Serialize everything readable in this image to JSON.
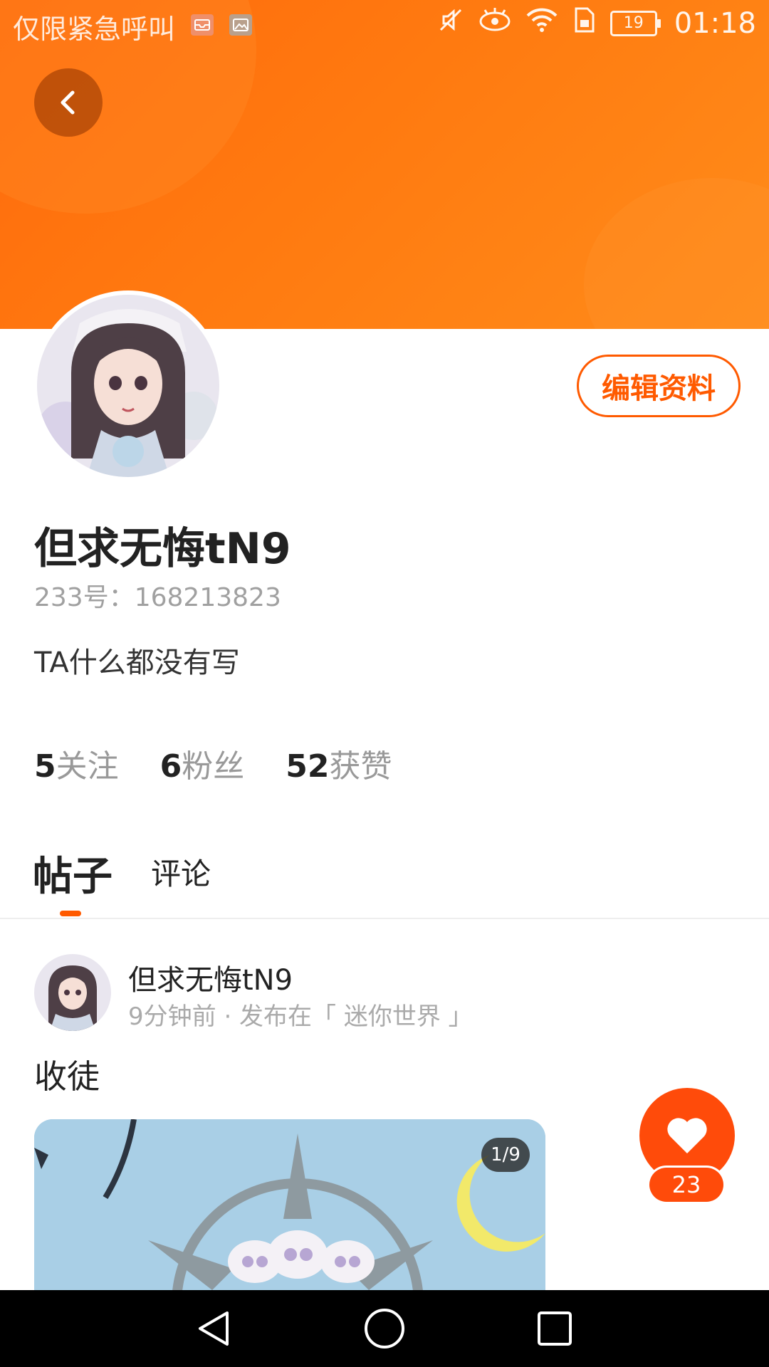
{
  "status_bar": {
    "carrier_text": "仅限紧急呼叫",
    "battery": "19",
    "time": "01:18",
    "icons": [
      "notification-mail-icon",
      "notification-image-icon",
      "mute-icon",
      "eye-comfort-icon",
      "wifi-icon",
      "sim-icon",
      "battery-icon"
    ]
  },
  "header": {
    "back_icon": "chevron-left-icon",
    "edit_profile_label": "编辑资料"
  },
  "profile": {
    "name": "但求无悔tN9",
    "id_text": "233号：168213823",
    "bio": "TA什么都没有写",
    "stats": [
      {
        "num": "5",
        "label": "关注"
      },
      {
        "num": "6",
        "label": "粉丝"
      },
      {
        "num": "52",
        "label": "获赞"
      }
    ]
  },
  "tabs": [
    {
      "label": "帖子",
      "active": true
    },
    {
      "label": "评论",
      "active": false
    }
  ],
  "post": {
    "author": "但求无悔tN9",
    "meta": "9分钟前 · 发布在「 迷你世界 」",
    "title": "收徒",
    "image_counter": "1/9",
    "like_count": "23"
  },
  "colors": {
    "accent": "#ff5a00",
    "header_gradient_start": "#ff6a0c",
    "header_gradient_end": "#ff8c1a",
    "like_red": "#ff4b0a"
  },
  "navbar": {
    "buttons": [
      "back-triangle-icon",
      "home-circle-icon",
      "recents-square-icon"
    ]
  }
}
